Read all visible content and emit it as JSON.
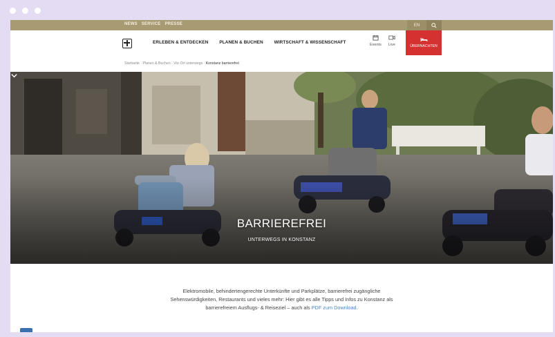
{
  "browser": {
    "dots": 3
  },
  "topbar": {
    "links": [
      "NEWS",
      "SERVICE",
      "PRESSE"
    ],
    "lang": "EN",
    "search_icon": "search-icon"
  },
  "nav": {
    "crest_icon": "constance-crest-icon",
    "items": [
      "ERLEBEN & ENTDECKEN",
      "PLANEN & BUCHEN",
      "WIRTSCHAFT & WISSENSCHAFT"
    ],
    "events": {
      "label": "Events",
      "icon": "calendar-icon"
    },
    "live": {
      "label": "Live",
      "icon": "camera-icon"
    },
    "cta": {
      "label": "ÜBERNACHTEN",
      "icon": "bed-icon"
    }
  },
  "breadcrumb": {
    "items": [
      "Startseite",
      "Planen & Buchen",
      "Vor Ort unterwegs"
    ],
    "separator": " · ",
    "current": "Konstanz barrierefrei"
  },
  "hero": {
    "title": "BARRIEREFREI",
    "subtitle": "UNTERWEGS IN KONSTANZ",
    "scroll_icon": "chevron-down-icon"
  },
  "intro": {
    "text": "Elektromobile, behindertengerechte Unterkünfte und Parkplätze, barrierefrei zugängliche Sehenswürdigkeiten, Restaurants und vieles mehr: Hier gibt es alle Tipps und Infos zu Konstanz als barrierefreiem Ausflugs- & Reiseziel – auch als ",
    "link": "PDF zum Download",
    "end": "."
  },
  "colors": {
    "topbar": "#a89a72",
    "cta": "#d63131",
    "link": "#4a86c5",
    "background": "#e4dcf3"
  }
}
